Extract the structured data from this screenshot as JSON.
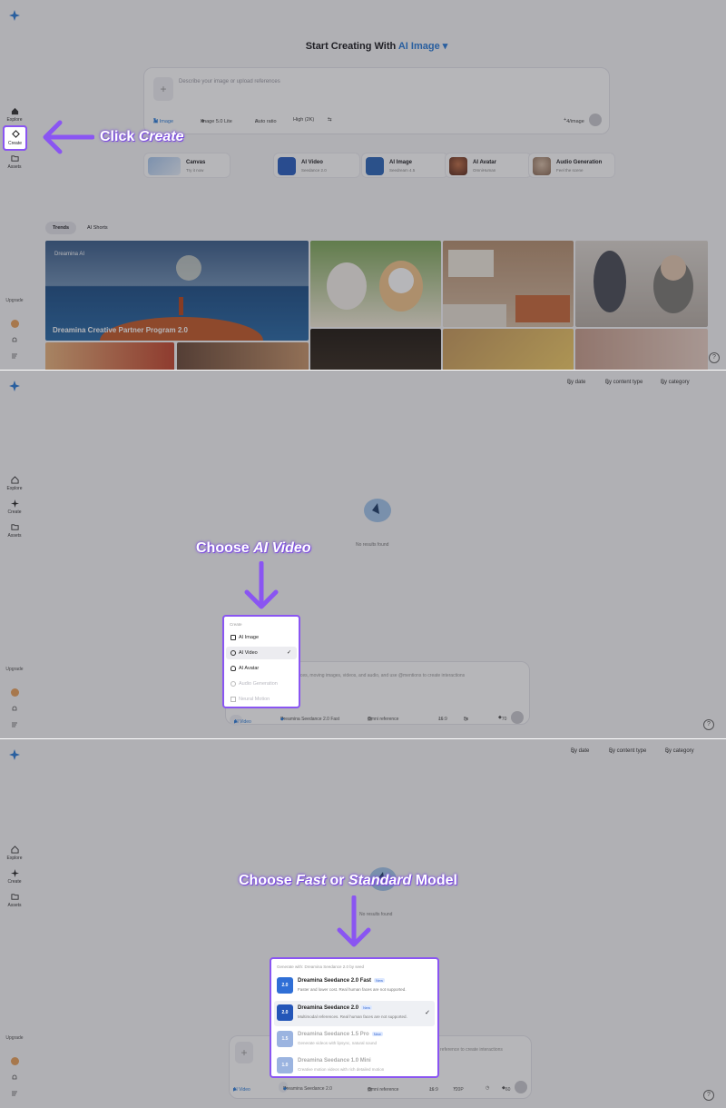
{
  "colors": {
    "accent": "#2a7bd8",
    "annotation": "#8a55f2",
    "dim_overlay": "rgba(40,40,50,0.34)"
  },
  "sidebar": {
    "items": [
      {
        "label": "Explore",
        "icon": "home-icon"
      },
      {
        "label": "Create",
        "icon": "diamond-sparkle-icon"
      },
      {
        "label": "Assets",
        "icon": "folder-icon"
      }
    ],
    "upgrade_label": "Upgrade",
    "logo_icon": "star-logo-icon"
  },
  "step1": {
    "headline": "Start Creating With",
    "headline_accent": "AI Image",
    "prompt_placeholder": "Describe your image or upload references",
    "tools": {
      "mode": "AI Image",
      "model": "Image 5.0 Lite",
      "ratio": "Auto ratio",
      "quality": "High (2K)",
      "count": "4/image"
    },
    "cards": [
      {
        "title": "Canvas",
        "subtitle": "Try it now"
      },
      {
        "title": "AI Video",
        "subtitle": "Seedance 2.0"
      },
      {
        "title": "AI Image",
        "subtitle": "Seedream 4.5"
      },
      {
        "title": "AI Avatar",
        "subtitle": "OmniHuman"
      },
      {
        "title": "Audio Generation",
        "subtitle": "Feel the scene"
      }
    ],
    "feed_tabs": [
      "Trends",
      "AI Shorts"
    ],
    "banner_brand": "Dreamina AI",
    "banner_title": "Dreamina Creative Partner Program 2.0",
    "annotation_prefix": "Click ",
    "annotation_target": "Create"
  },
  "step2": {
    "filters": [
      "By date",
      "By content type",
      "By category"
    ],
    "empty_text": "No results found",
    "prompt_text": "references, moving images, videos, and audio, and use @mentions to create interactions",
    "annotation_prefix": "Choose ",
    "annotation_target": "AI Video",
    "menu": {
      "header": "Create",
      "items": [
        {
          "label": "AI Image",
          "icon": "image-icon",
          "selected": false,
          "disabled": false
        },
        {
          "label": "AI Video",
          "icon": "video-icon",
          "selected": true,
          "disabled": false
        },
        {
          "label": "AI Avatar",
          "icon": "avatar-icon",
          "selected": false,
          "disabled": false
        },
        {
          "label": "Audio Generation",
          "icon": "audio-icon",
          "selected": false,
          "disabled": true
        },
        {
          "label": "Neural Motion",
          "icon": "motion-icon",
          "selected": false,
          "disabled": true
        }
      ]
    },
    "bottom": {
      "mode": "AI Video",
      "model": "Dreamina Seedance 2.0 Fast",
      "reference": "Omni reference",
      "ratio": "16:9",
      "duration": "5s",
      "credits": "70"
    }
  },
  "step3": {
    "filters": [
      "By date",
      "By content type",
      "By category"
    ],
    "empty_text": "No results found",
    "prompt_text": "reference to create interactions",
    "annotation_parts": [
      "Choose ",
      "Fast",
      " or ",
      "Standard",
      " Model"
    ],
    "menu": {
      "header": "Generate with: Dreamina Seedance 2.0 by seed",
      "new_badge": "New",
      "items": [
        {
          "name": "Dreamina Seedance 2.0 Fast",
          "desc": "Faster and lower cost. Real human faces are not supported.",
          "badge": true,
          "selected": false,
          "faded": false,
          "icon": "seedance-fast-icon",
          "color": "#2f6fd6"
        },
        {
          "name": "Dreamina Seedance 2.0",
          "desc": "Multimodal references. Real human faces are not supported.",
          "badge": true,
          "selected": true,
          "faded": false,
          "icon": "seedance-icon",
          "color": "#2456b8"
        },
        {
          "name": "Dreamina Seedance 1.5 Pro",
          "desc": "Generate videos with lipsync, natural sound",
          "badge": true,
          "selected": false,
          "faded": true,
          "icon": "seedance-pro-icon",
          "color": "#4b78c8"
        },
        {
          "name": "Dreamina Seedance 1.0 Mini",
          "desc": "Creative motion videos with rich detailed motion",
          "badge": false,
          "selected": false,
          "faded": true,
          "icon": "seedance-mini-icon",
          "color": "#4b78c8"
        }
      ]
    },
    "bottom": {
      "mode": "AI Video",
      "model": "Dreamina Seedance 2.0",
      "reference": "Omni reference",
      "ratio": "16:9",
      "resolution": "720P",
      "credits": "60"
    }
  }
}
